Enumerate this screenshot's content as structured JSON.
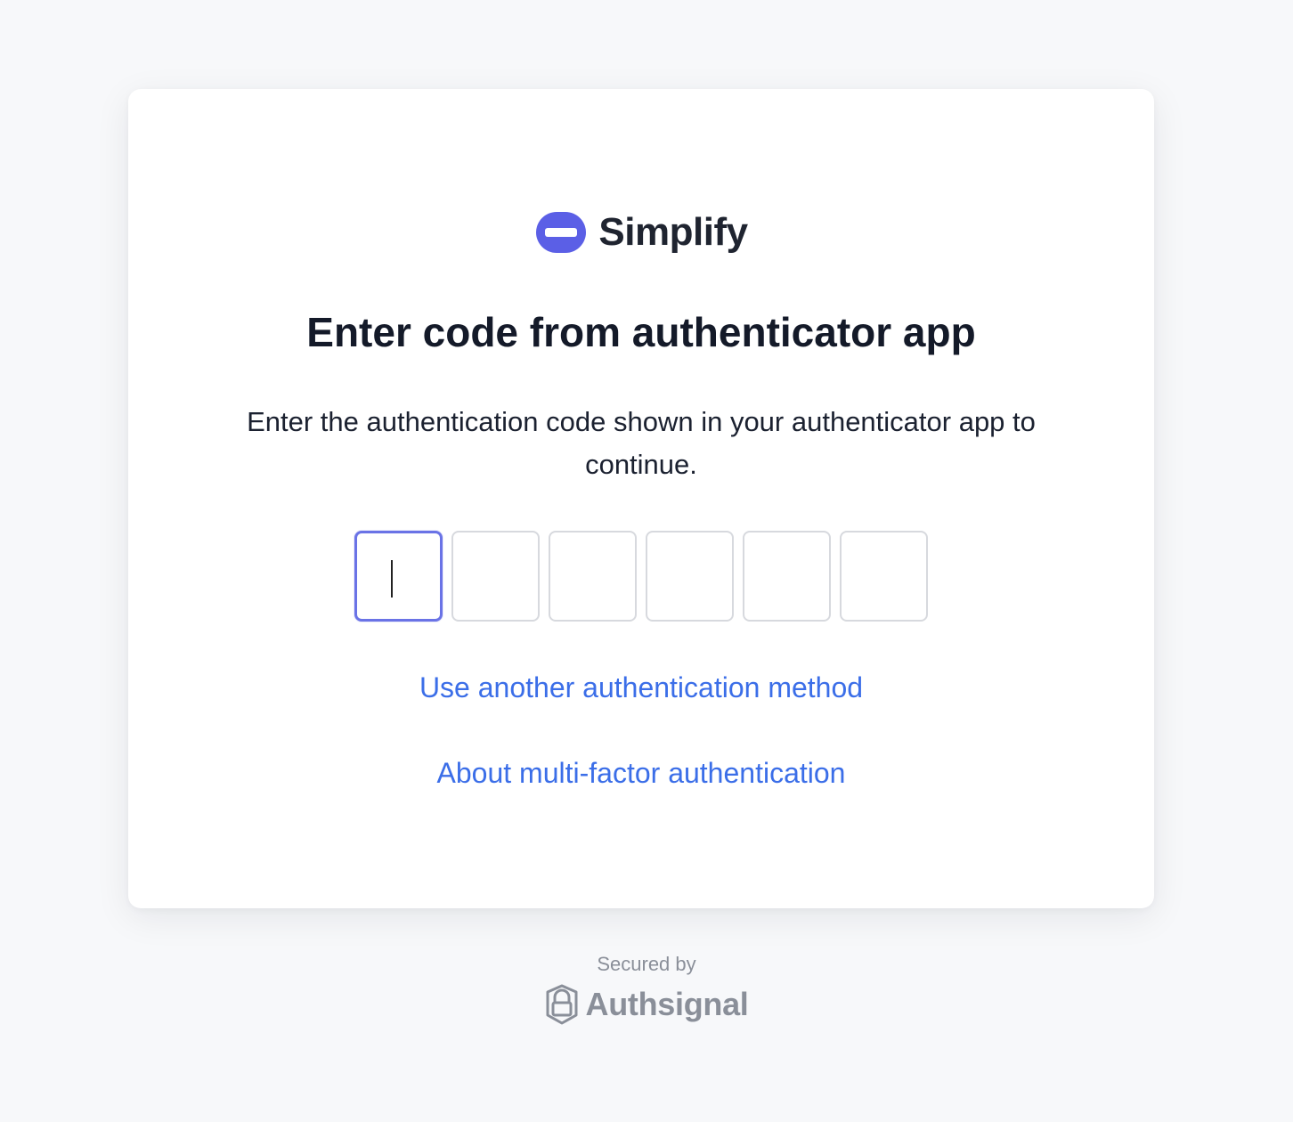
{
  "brand": {
    "name": "Simplify",
    "color": "#5b5fe6"
  },
  "page": {
    "title": "Enter code from authenticator app",
    "description": "Enter the authentication code shown in your authenticator app to continue."
  },
  "code_input": {
    "digits": [
      "",
      "",
      "",
      "",
      "",
      ""
    ],
    "active_index": 0,
    "active_color": "#6a73e6"
  },
  "links": {
    "other_method": "Use another authentication method",
    "about_mfa": "About multi-factor authentication",
    "color": "#3b6ee8"
  },
  "footer": {
    "secured_by": "Secured by",
    "provider_name": "Authsignal"
  },
  "icons": {
    "brand_logo": "simplify-logo",
    "provider_logo": "authsignal-shield-logo"
  }
}
